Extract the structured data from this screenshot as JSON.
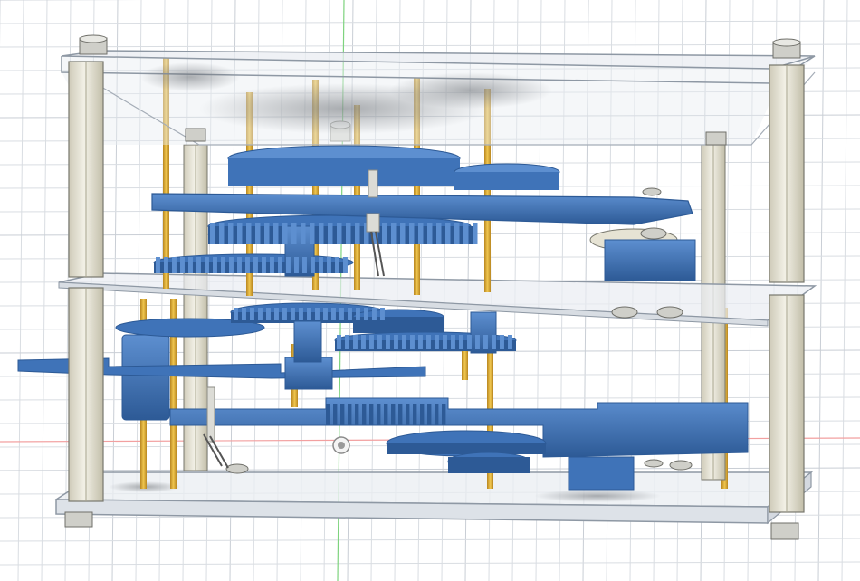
{
  "viewport": {
    "background": "#ffffff",
    "grid_color": "#d9dde2",
    "grid_major_color": "#c9ced5",
    "axis_green": "#7ed37e",
    "axis_red": "#f2a0a0"
  },
  "model": {
    "gear_color": "#3f73b8",
    "gear_dark": "#2d5a96",
    "gear_light": "#5d8fd0",
    "brass_color": "#e2b23c",
    "brass_dark": "#b8861f",
    "plate_fill": "#e9edf2",
    "plate_edge": "#8e98a4",
    "standoff_color": "#e6e3d4",
    "standoff_edge": "#77776d",
    "screw_color": "#cfcfc9",
    "plates": [
      "top-plate",
      "middle-plate",
      "bottom-plate"
    ],
    "standoff_count": 4,
    "icons": [
      "origin-marker-icon"
    ]
  }
}
